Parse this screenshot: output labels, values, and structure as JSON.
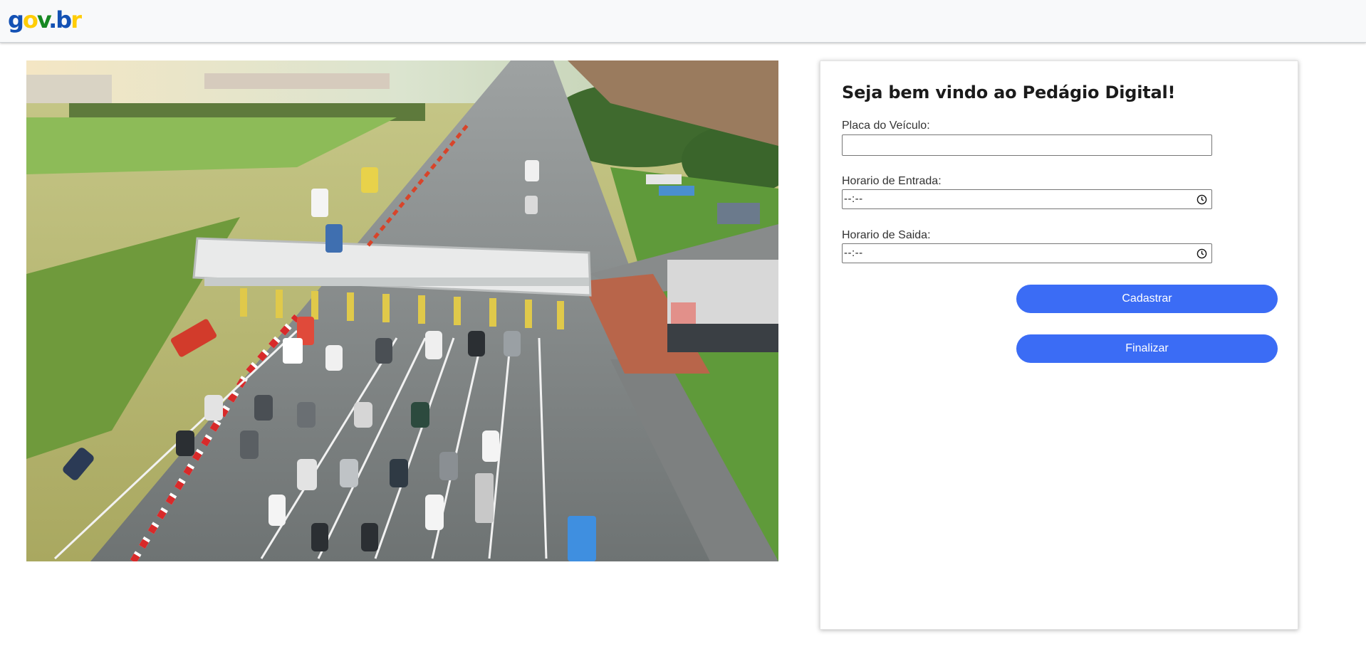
{
  "header": {
    "logo": {
      "g": "g",
      "o": "o",
      "v": "v",
      "dot": ".",
      "b": "b",
      "r": "r",
      "alt": "gov.br"
    },
    "colors": {
      "blue": "#1351b4",
      "yellow": "#ffcd07",
      "green": "#168821"
    }
  },
  "hero_image": {
    "icon": "toll-plaza-aerial-photo"
  },
  "form": {
    "title": "Seja bem vindo ao Pedágio Digital!",
    "plate": {
      "label": "Placa do Veículo:",
      "value": "",
      "placeholder": ""
    },
    "entry_time": {
      "label": "Horario de Entrada:",
      "value": "--:--",
      "icon": "clock-icon"
    },
    "exit_time": {
      "label": "Horario de Saida:",
      "value": "--:--",
      "icon": "clock-icon"
    },
    "buttons": {
      "register": "Cadastrar",
      "finish": "Finalizar"
    },
    "accent_color": "#3b6cf5"
  }
}
